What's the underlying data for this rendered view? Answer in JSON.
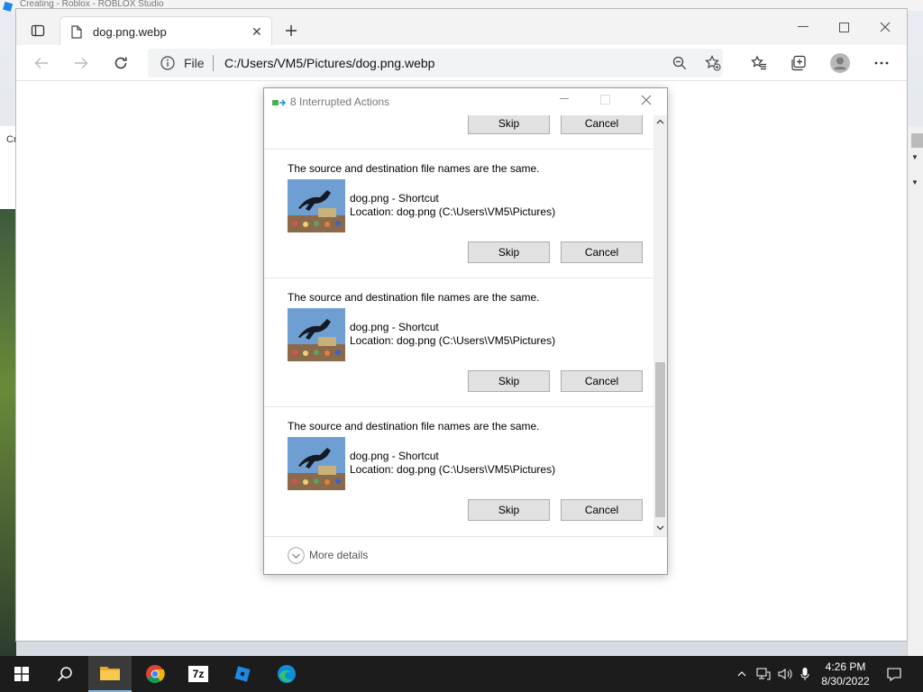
{
  "background_app": {
    "title": "Creating - Roblox - ROBLOX Studio"
  },
  "browser": {
    "tab_title": "dog.png.webp",
    "url_prefix": "File",
    "url": "C:/Users/VM5/Pictures/dog.png.webp"
  },
  "dialog": {
    "title": "8 Interrupted Actions",
    "items": [
      {
        "skip_label": "Skip",
        "cancel_label": "Cancel"
      },
      {
        "message": "The source and destination file names are the same.",
        "file_name": "dog.png - Shortcut",
        "location": "Location: dog.png (C:\\Users\\VM5\\Pictures)",
        "skip_label": "Skip",
        "cancel_label": "Cancel"
      },
      {
        "message": "The source and destination file names are the same.",
        "file_name": "dog.png - Shortcut",
        "location": "Location: dog.png (C:\\Users\\VM5\\Pictures)",
        "skip_label": "Skip",
        "cancel_label": "Cancel"
      },
      {
        "message": "The source and destination file names are the same.",
        "file_name": "dog.png - Shortcut",
        "location": "Location: dog.png (C:\\Users\\VM5\\Pictures)",
        "skip_label": "Skip",
        "cancel_label": "Cancel"
      }
    ],
    "more_details_label": "More details"
  },
  "background_left": {
    "label": "Cr"
  },
  "taskbar": {
    "apps": [
      "start-icon",
      "search-icon",
      "file-explorer-icon",
      "chrome-icon",
      "7zip-icon",
      "roblox-studio-icon",
      "edge-icon"
    ],
    "sevenzip_label": "7z",
    "time": "4:26 PM",
    "date": "8/30/2022"
  },
  "colors": {
    "taskbar": "#1c1c1c",
    "accent": "#0078d4",
    "button": "#e1e1e1"
  }
}
